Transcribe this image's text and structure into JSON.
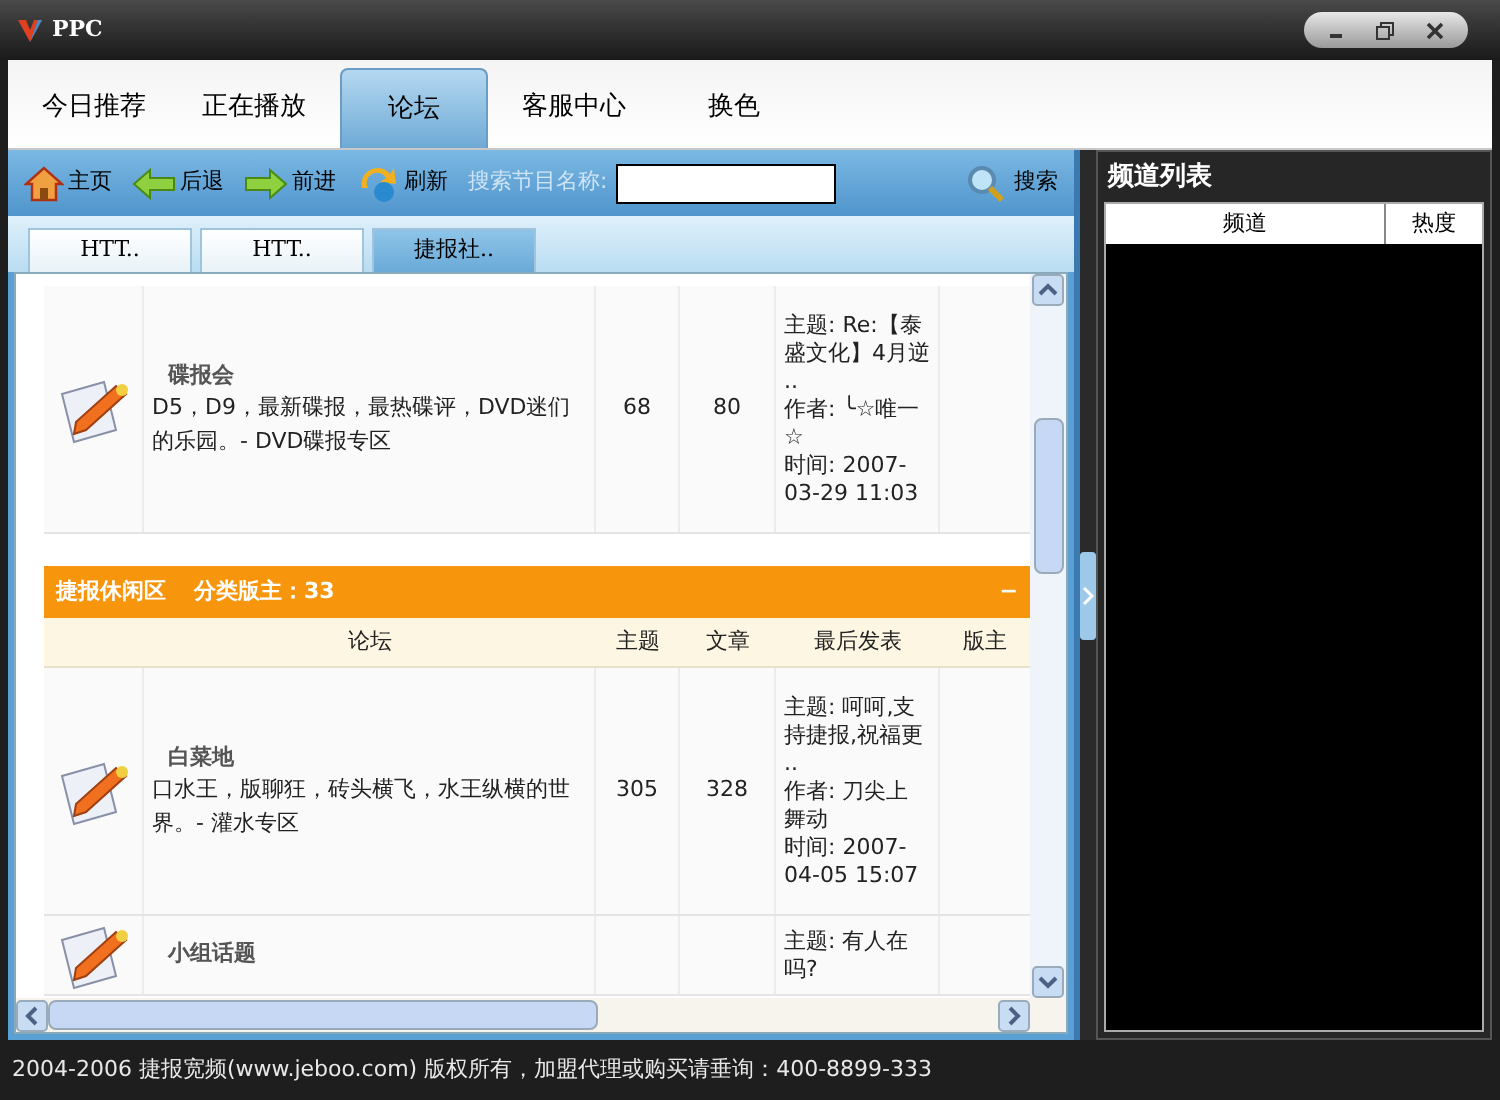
{
  "window": {
    "title": "PPC"
  },
  "tabs": [
    {
      "label": "今日推荐",
      "selected": false
    },
    {
      "label": "正在播放",
      "selected": false
    },
    {
      "label": "论坛",
      "selected": true
    },
    {
      "label": "客服中心",
      "selected": false
    },
    {
      "label": "换色",
      "selected": false
    }
  ],
  "toolbar": {
    "items": [
      {
        "kind": "home",
        "label": "主页"
      },
      {
        "kind": "back",
        "label": "后退"
      },
      {
        "kind": "forward",
        "label": "前进"
      },
      {
        "kind": "refresh",
        "label": "刷新"
      }
    ],
    "search_label": "搜索节目名称:",
    "search_button": "搜索"
  },
  "page_tabs": [
    {
      "label": "HTT..",
      "selected": false
    },
    {
      "label": "HTT..",
      "selected": false
    },
    {
      "label": "捷报社..",
      "selected": true
    }
  ],
  "forum_list": [
    {
      "kind": "forum",
      "name": "碟报会",
      "description": "D5，D9，最新碟报，最热碟评，DVD迷们的乐园。- DVD碟报专区",
      "topics": "68",
      "posts": "80",
      "last_post": [
        "主题: Re:【泰盛文化】4月逆 ..",
        "作者: ╰☆唯一☆",
        "时间: 2007-03-29 11:03"
      ]
    },
    {
      "kind": "category",
      "title": "捷报休闲区",
      "moderator": "分类版主：33",
      "collapse": "−"
    },
    {
      "kind": "columns",
      "columns": [
        "论坛",
        "主题",
        "文章",
        "最后发表",
        "版主"
      ]
    },
    {
      "kind": "forum",
      "name": "白菜地",
      "description": "口水王，版聊狂，砖头横飞，水王纵横的世界。- 灌水专区",
      "topics": "305",
      "posts": "328",
      "last_post": [
        "主题: 呵呵,支持捷报,祝福更 ..",
        "作者: 刀尖上舞动",
        "时间: 2007-04-05 15:07"
      ]
    },
    {
      "kind": "forum",
      "name": "小组话题",
      "last_post": [
        "主题: 有人在吗?"
      ]
    }
  ],
  "channel_panel": {
    "title": "频道列表",
    "columns": [
      "频道",
      "热度"
    ]
  },
  "status_bar": "2004-2006 捷报宽频(www.jeboo.com) 版权所有，加盟代理或购买请垂询：400-8899-333"
}
